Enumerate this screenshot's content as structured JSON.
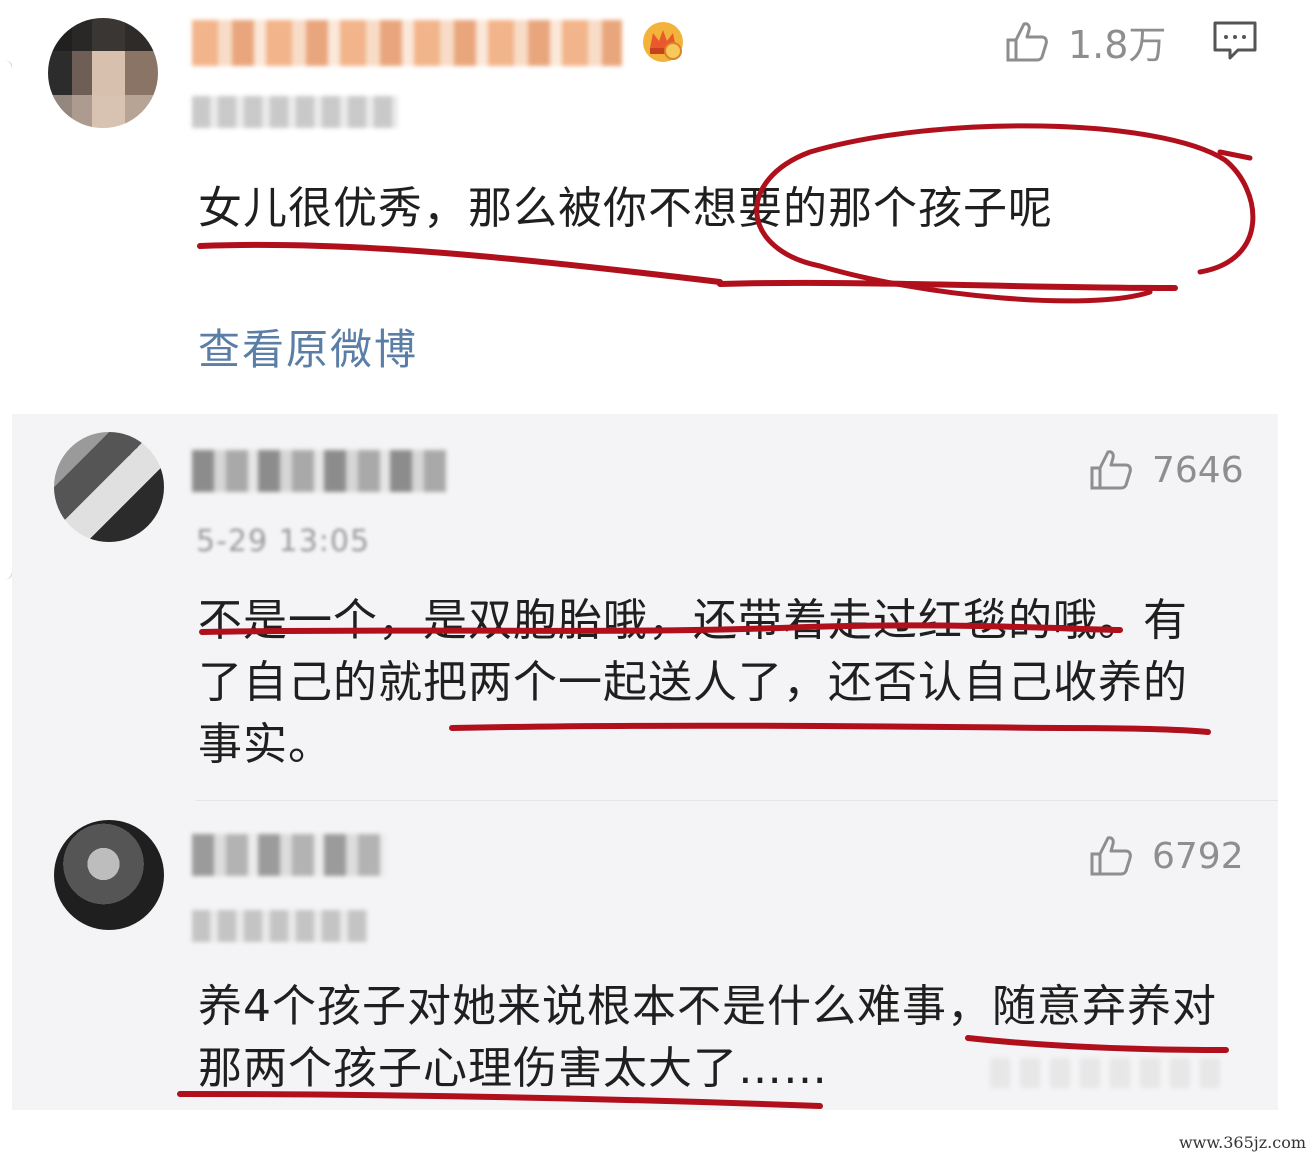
{
  "main_comment": {
    "likes": "1.8万",
    "text": "女儿很优秀，那么被你不想要的那个孩子呢",
    "view_original": "查看原微博"
  },
  "replies": [
    {
      "time": "5-29 13:05",
      "likes": "7646",
      "text": "不是一个，是双胞胎哦，还带着走过红毯的哦。有了自己的就把两个一起送人了，还否认自己收养的事实。"
    },
    {
      "likes": "6792",
      "text": "养4个孩子对她来说根本不是什么难事，随意弃养对那两个孩子心理伤害太大了……"
    }
  ],
  "watermark": "www.365jz.com",
  "colors": {
    "annotation_red": "#b0101c",
    "link_blue": "#5b7ea6",
    "reply_bg": "#f4f4f6",
    "icon_gray": "#8e8e8e"
  },
  "icons": {
    "like": "thumbs-up-icon",
    "comment": "comment-bubble-icon",
    "vip": "crown-badge-icon"
  }
}
